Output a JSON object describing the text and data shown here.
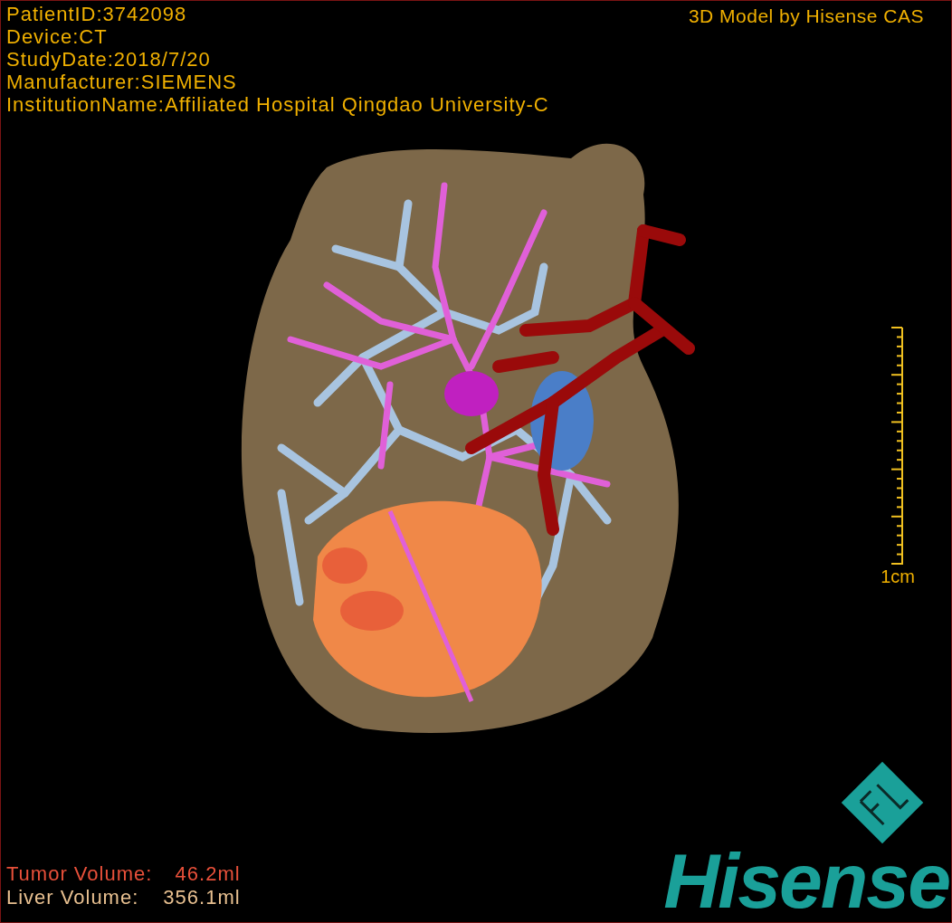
{
  "info_lines": [
    "PatientID:3742098",
    "Device:CT",
    "StudyDate:2018/7/20",
    "Manufacturer:SIEMENS",
    "InstitutionName:Affiliated Hospital Qingdao University-C"
  ],
  "title": "3D Model by Hisense CAS",
  "scale_bar": {
    "label": "1cm"
  },
  "volumes": [
    {
      "kind": "tumor",
      "label": "Tumor Volume:",
      "value": "46.2ml"
    },
    {
      "kind": "liver",
      "label": "Liver Volume:",
      "value": "356.1ml"
    }
  ],
  "logo": {
    "text": "Hisense"
  }
}
